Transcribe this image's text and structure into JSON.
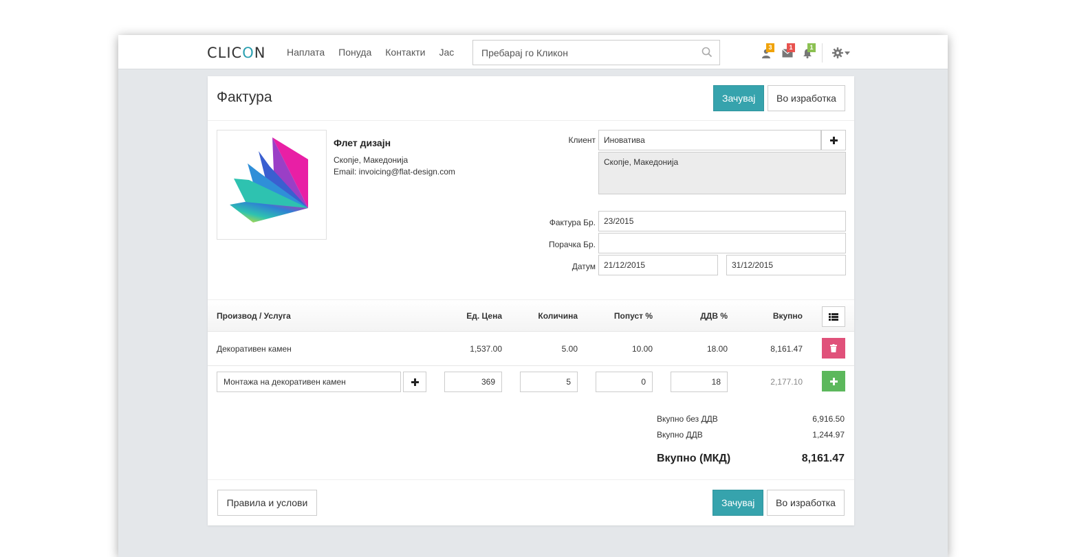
{
  "app": {
    "logo_prefix": "CLIC",
    "logo_o": "O",
    "logo_suffix": "N",
    "nav": [
      "Наплата",
      "Понуда",
      "Контакти",
      "Јас"
    ],
    "search_placeholder": "Пребарај го Кликон",
    "badges": {
      "users": "3",
      "messages": "1",
      "notifications": "1"
    },
    "badge_colors": {
      "users": "#f0a30a",
      "messages": "#e8534f",
      "notifications": "#8cc152"
    }
  },
  "invoice": {
    "title": "Фактура",
    "save_label": "Зачувај",
    "draft_label": "Во изработка",
    "terms_label": "Правила и услови",
    "company": {
      "name": "Флет дизајн",
      "city": "Скопје, Македонија",
      "email": "Email: invoicing@flat-design.com"
    },
    "client_label": "Клиент",
    "client_value": "Иновативa",
    "client_address": "Скопје, Македонија",
    "invoice_no_label": "Фактура Бр.",
    "invoice_no": "23/2015",
    "order_no_label": "Порачка Бр.",
    "order_no": "",
    "date_label": "Датум",
    "date_issued": "21/12/2015",
    "date_due": "31/12/2015"
  },
  "table": {
    "headers": {
      "product": "Производ / Услуга",
      "unit_price": "Ед. Цена",
      "quantity": "Количина",
      "discount": "Попуст %",
      "vat": "ДДВ %",
      "total": "Вкупно"
    },
    "rows": [
      {
        "product": "Декоративен камен",
        "unit_price": "1,537.00",
        "quantity": "5.00",
        "discount": "10.00",
        "vat": "18.00",
        "total": "8,161.47"
      }
    ],
    "new_row": {
      "product": "Монтажа на декоративен камен",
      "unit_price": "369",
      "quantity": "5",
      "discount": "0",
      "vat": "18",
      "total": "2,177.10"
    }
  },
  "totals": {
    "subtotal_label": "Вкупно без ДДВ",
    "subtotal": "6,916.50",
    "vat_label": "Вкупно ДДВ",
    "vat": "1,244.97",
    "grand_label": "Вкупно (МКД)",
    "grand": "8,161.47"
  },
  "colors": {
    "primary": "#36a3ad",
    "danger": "#e0517a",
    "success": "#5cb85c"
  }
}
